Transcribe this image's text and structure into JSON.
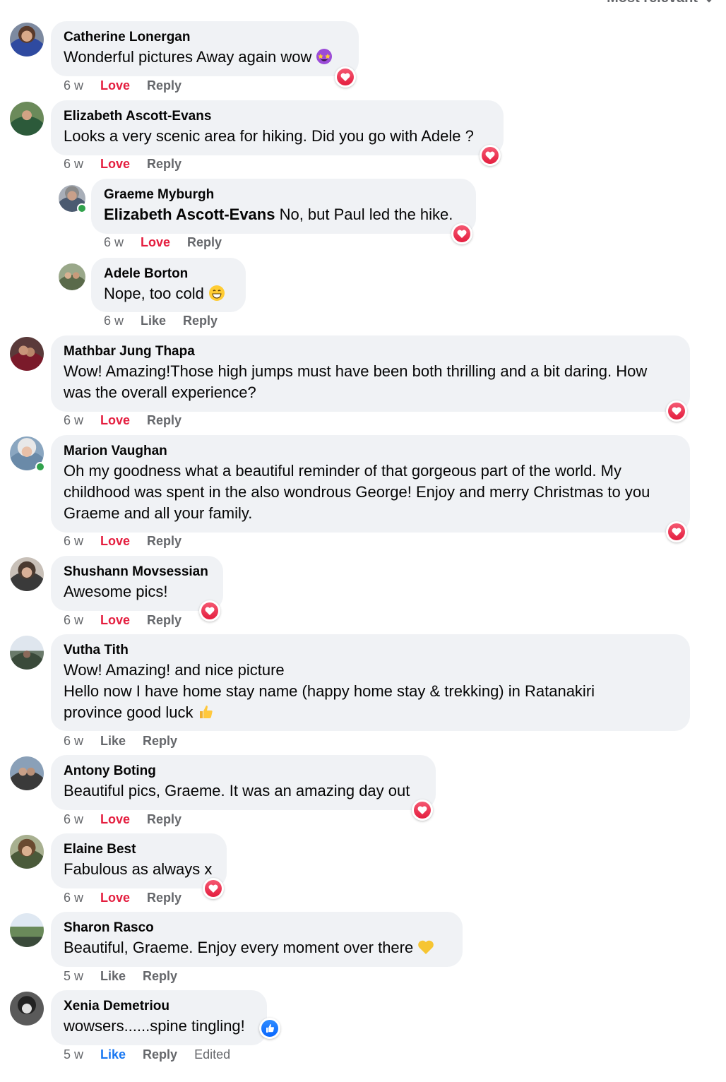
{
  "sort": {
    "label": "Most relevant"
  },
  "comments": [
    {
      "author": "Catherine Lonergan",
      "text": "Wonderful pictures Away again wow",
      "time": "6 w",
      "react": "Love",
      "reply": "Reply"
    },
    {
      "author": "Elizabeth Ascott-Evans",
      "text": "Looks a very scenic area for hiking. Did you go with Adele ?",
      "time": "6 w",
      "react": "Love",
      "reply": "Reply"
    },
    {
      "author": "Graeme Myburgh",
      "mention": "Elizabeth Ascott-Evans",
      "text": " No, but Paul led the hike.",
      "time": "6 w",
      "react": "Love",
      "reply": "Reply"
    },
    {
      "author": "Adele Borton",
      "text": "Nope, too cold",
      "time": "6 w",
      "react": "Like",
      "reply": "Reply"
    },
    {
      "author": "Mathbar Jung Thapa",
      "text_lines": [
        "Wow! Amazing!Those high jumps must have been both thrilling and a bit daring. How",
        "was the overall experience?"
      ],
      "time": "6 w",
      "react": "Love",
      "reply": "Reply"
    },
    {
      "author": "Marion Vaughan",
      "text_lines": [
        "Oh my goodness what a beautiful reminder of that gorgeous part of the world. My",
        "childhood was spent in the also wondrous George! Enjoy and merry Christmas to you",
        "Graeme and all your family."
      ],
      "time": "6 w",
      "react": "Love",
      "reply": "Reply"
    },
    {
      "author": "Shushann Movsessian",
      "text": "Awesome pics!",
      "time": "6 w",
      "react": "Love",
      "reply": "Reply"
    },
    {
      "author": "Vutha Tith",
      "text_lines": [
        "Wow! Amazing! and nice picture",
        "Hello now I have home stay name (happy home stay & trekking) in Ratanakiri",
        "province good luck"
      ],
      "time": "6 w",
      "react": "Like",
      "reply": "Reply"
    },
    {
      "author": "Antony Boting",
      "text": "Beautiful pics, Graeme. It was an amazing day out",
      "time": "6 w",
      "react": "Love",
      "reply": "Reply"
    },
    {
      "author": "Elaine Best",
      "text": "Fabulous as always x",
      "time": "6 w",
      "react": "Love",
      "reply": "Reply"
    },
    {
      "author": "Sharon Rasco",
      "text": "Beautiful, Graeme. Enjoy every moment over there",
      "time": "5 w",
      "react": "Like",
      "reply": "Reply"
    },
    {
      "author": "Xenia Demetriou",
      "text": "wowsers......spine tingling!",
      "time": "5 w",
      "react": "Like",
      "reply": "Reply",
      "edited": "Edited"
    }
  ],
  "colors": {
    "love": "#e41e3f",
    "like": "#1877f2",
    "bubble": "#f0f2f5",
    "meta": "#65676b",
    "online": "#31a24c"
  }
}
